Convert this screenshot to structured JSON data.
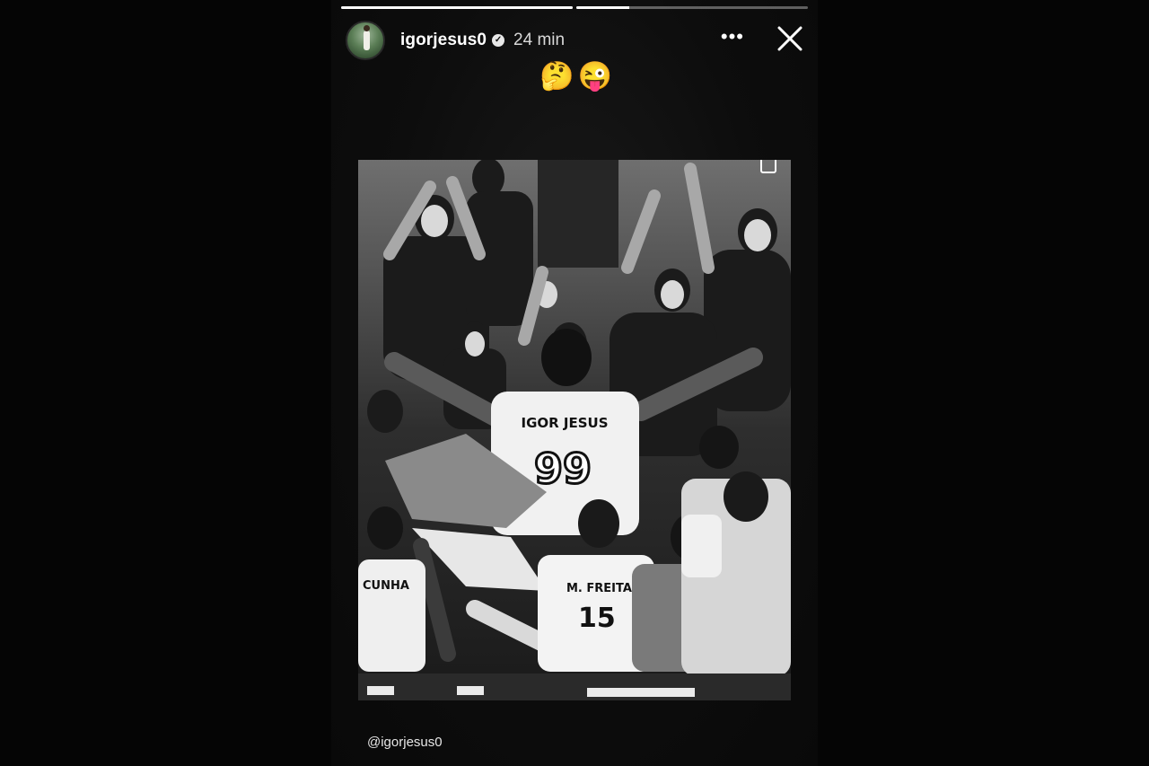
{
  "story": {
    "username": "igorjesus0",
    "time": "24 min",
    "emojis": "🤔😜",
    "mention": "@igorjesus0",
    "progress": [
      1.0,
      0.23
    ],
    "icons": {
      "verified": "verified-badge-icon",
      "more": "more-options-icon",
      "close": "close-icon"
    }
  },
  "photo": {
    "jerseys": {
      "main_name": "IGOR JESUS",
      "main_number": "99",
      "left_bottom_name": "CUNHA",
      "center_bottom_name": "M. FREITAS"
    }
  },
  "colors": {
    "background": "#050505",
    "story_panel": "#0c0c0c",
    "text": "#ffffff"
  }
}
